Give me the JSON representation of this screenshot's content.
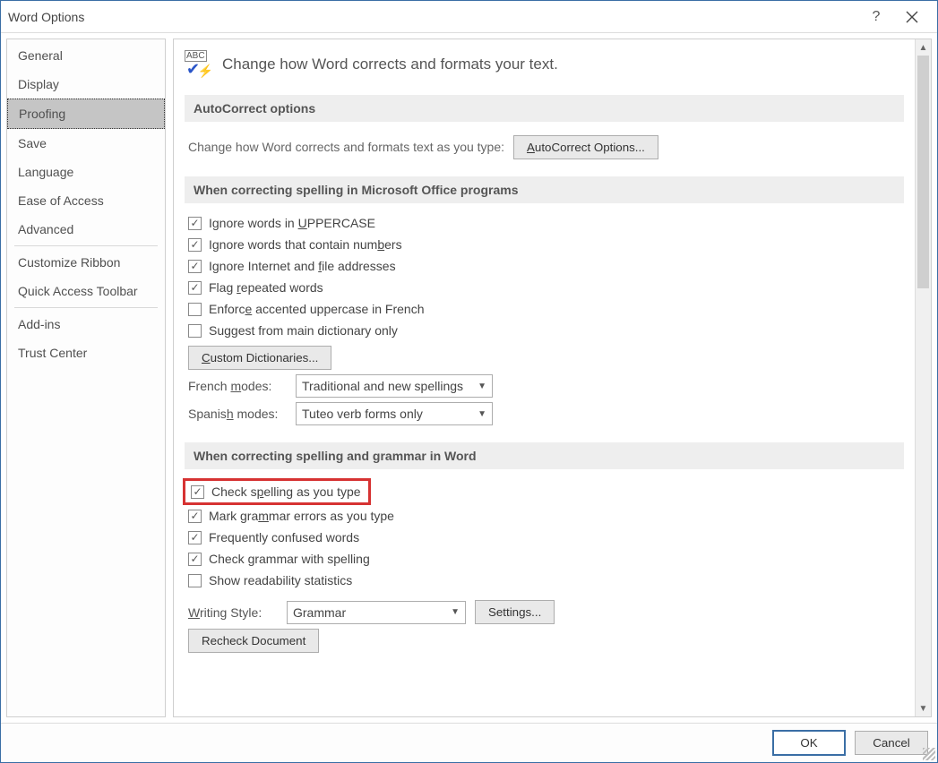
{
  "window": {
    "title": "Word Options",
    "help_tooltip": "?",
    "close_tooltip": "Close"
  },
  "sidebar": {
    "items": [
      {
        "label": "General"
      },
      {
        "label": "Display"
      },
      {
        "label": "Proofing",
        "selected": true
      },
      {
        "label": "Save"
      },
      {
        "label": "Language"
      },
      {
        "label": "Ease of Access"
      },
      {
        "label": "Advanced"
      },
      {
        "sep": true
      },
      {
        "label": "Customize Ribbon"
      },
      {
        "label": "Quick Access Toolbar"
      },
      {
        "sep": true
      },
      {
        "label": "Add-ins"
      },
      {
        "label": "Trust Center"
      }
    ]
  },
  "header_text": "Change how Word corrects and formats your text.",
  "section_autocorrect": {
    "title": "AutoCorrect options",
    "desc": "Change how Word corrects and formats text as you type:",
    "button": "AutoCorrect Options..."
  },
  "section_office": {
    "title": "When correcting spelling in Microsoft Office programs",
    "opt_upper_pre": "Ignore words in ",
    "opt_upper_letter": "U",
    "opt_upper_post": "PPERCASE",
    "opt_numbers_pre": "Ignore words that contain num",
    "opt_numbers_letter": "b",
    "opt_numbers_post": "ers",
    "opt_internet_pre": "Ignore Internet and ",
    "opt_internet_letter": "f",
    "opt_internet_post": "ile addresses",
    "opt_repeated_pre": "Flag ",
    "opt_repeated_letter": "r",
    "opt_repeated_post": "epeated words",
    "opt_french_pre": "Enforc",
    "opt_french_letter": "e",
    "opt_french_post": " accented uppercase in French",
    "opt_mainonly": "Suggest from main dictionary only",
    "custom_dict_btn_letter": "C",
    "custom_dict_btn_post": "ustom Dictionaries...",
    "french_label_pre": "French ",
    "french_label_letter": "m",
    "french_label_post": "odes:",
    "french_value": "Traditional and new spellings",
    "spanish_label_pre": "Spanis",
    "spanish_label_letter": "h",
    "spanish_label_post": " modes:",
    "spanish_value": "Tuteo verb forms only"
  },
  "section_word": {
    "title": "When correcting spelling and grammar in Word",
    "opt_spelltype_pre": "Check s",
    "opt_spelltype_letter": "p",
    "opt_spelltype_post": "elling as you type",
    "opt_grammar_pre": "Mark gra",
    "opt_grammar_letter": "m",
    "opt_grammar_post": "mar errors as you type",
    "opt_confused": "Frequently confused words",
    "opt_checkgrammar": "Check grammar with spelling",
    "opt_readability": "Show readability statistics",
    "writing_style_pre": "",
    "writing_style_letter": "W",
    "writing_style_post": "riting Style:",
    "writing_style_value": "Grammar",
    "settings_btn": "Settings...",
    "recheck_btn": "Recheck Document"
  },
  "checkbox_states": {
    "ignore_upper": true,
    "ignore_numbers": true,
    "ignore_internet": true,
    "flag_repeated": true,
    "enforce_french": false,
    "main_only": false,
    "spell_type": true,
    "grammar_type": true,
    "confused": true,
    "check_grammar_spell": true,
    "readability": false
  },
  "footer": {
    "ok": "OK",
    "cancel": "Cancel"
  }
}
